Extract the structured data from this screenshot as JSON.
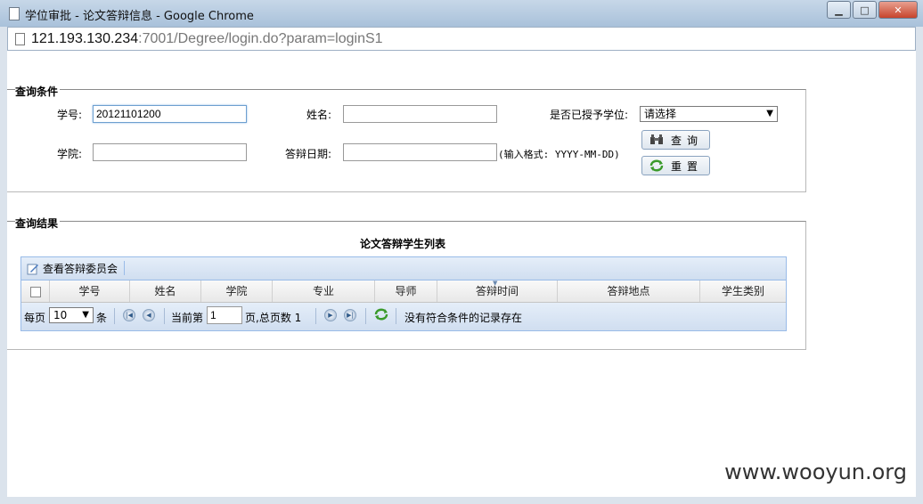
{
  "window": {
    "title": "学位审批 - 论文答辩信息 - Google Chrome",
    "minimize_glyph": "▁",
    "maximize_glyph": "□",
    "close_glyph": "✕"
  },
  "address": {
    "host": "121.193.130.234",
    "path": ":7001/Degree/login.do?param=loginS1"
  },
  "query": {
    "legend": "查询条件",
    "student_id_label": "学号:",
    "student_id_value": "20121101200",
    "name_label": "姓名:",
    "name_value": "",
    "degree_label": "是否已授予学位:",
    "degree_selected": "请选择",
    "college_label": "学院:",
    "college_value": "",
    "defense_date_label": "答辩日期:",
    "defense_date_value": "",
    "date_hint": "(输入格式: YYYY-MM-DD)",
    "search_button": "查询",
    "reset_button": "重置"
  },
  "results": {
    "legend": "查询结果",
    "table_title": "论文答辩学生列表",
    "toolbar_button": "查看答辩委员会",
    "columns": [
      "学号",
      "姓名",
      "学院",
      "专业",
      "导师",
      "答辩时间",
      "答辩地点",
      "学生类别"
    ],
    "pager": {
      "per_page_label": "每页",
      "per_page_value": "10",
      "items_unit": "条",
      "current_label": "当前第",
      "current_page": "1",
      "total_label": "页,总页数 1",
      "empty_message": "没有符合条件的记录存在"
    }
  },
  "watermark": "www.wooyun.org",
  "colors": {
    "accent_border": "#99bbe8",
    "toolbar_bg": "#d0def0",
    "refresh_icon": "#3a9a2a"
  }
}
